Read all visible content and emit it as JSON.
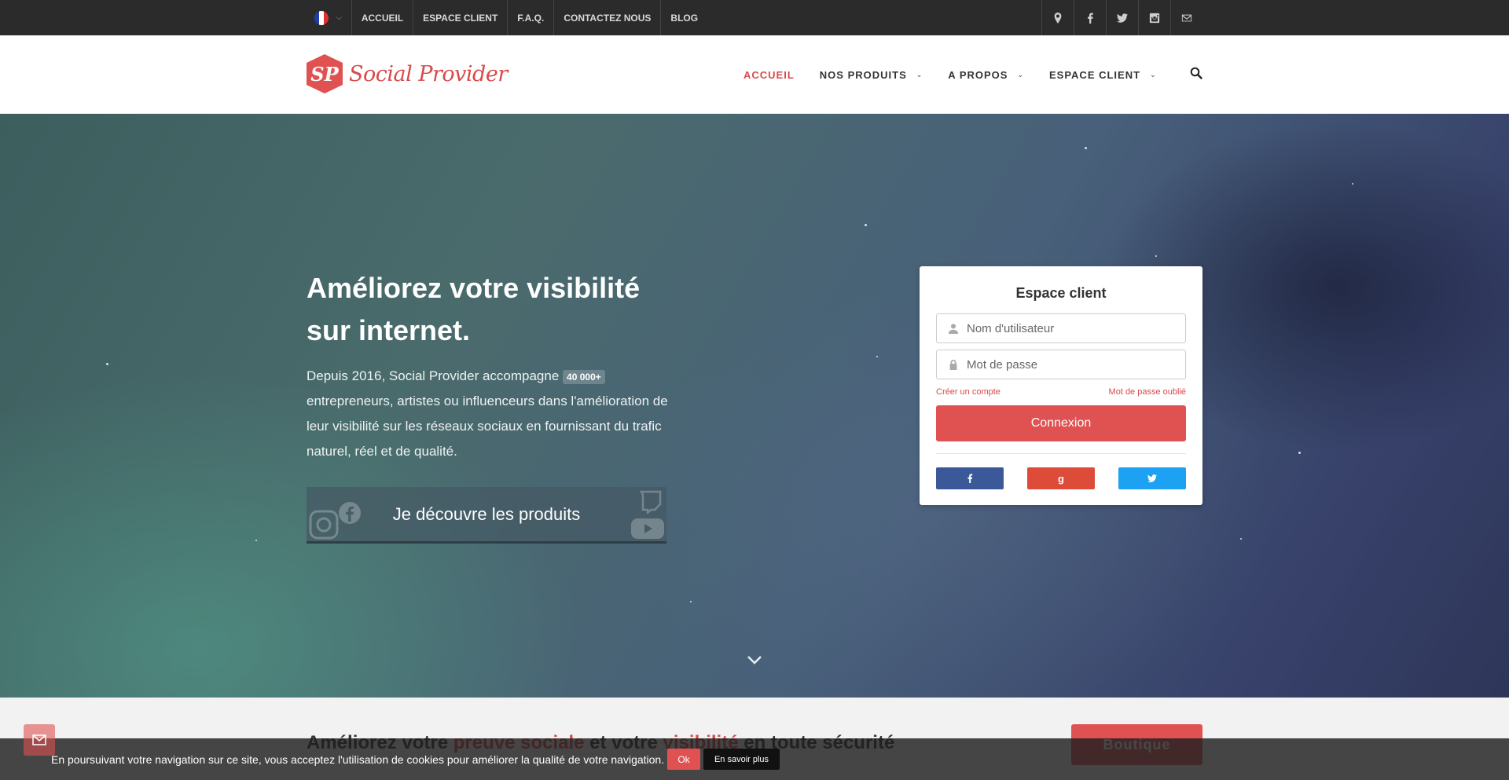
{
  "topbar": {
    "language_flag": "fr-flag-icon",
    "links": [
      "ACCUEIL",
      "ESPACE CLIENT",
      "F.A.Q.",
      "CONTACTEZ NOUS",
      "BLOG"
    ],
    "icons": [
      "map-pin-icon",
      "facebook-icon",
      "twitter-icon",
      "instagram-icon",
      "mail-icon"
    ]
  },
  "header": {
    "logo_mark": "SP",
    "logo_text": "Social Provider",
    "nav": [
      {
        "label": "ACCUEIL",
        "active": true
      },
      {
        "label": "NOS PRODUITS",
        "dropdown": true
      },
      {
        "label": "A PROPOS",
        "dropdown": true
      },
      {
        "label": "ESPACE CLIENT",
        "dropdown": true
      }
    ],
    "search_icon": "search-icon"
  },
  "hero": {
    "title": "Améliorez votre visibilité sur internet.",
    "text_before": "Depuis 2016, Social Provider accompagne",
    "badge": "40 000+",
    "text_after": "entrepreneurs, artistes ou influenceurs dans l'amélioration de leur visibilité sur les réseaux sociaux en fournissant du trafic naturel, réel et de qualité.",
    "cta": "Je découvre les produits"
  },
  "login": {
    "title": "Espace client",
    "username_placeholder": "Nom d'utilisateur",
    "password_placeholder": "Mot de passe",
    "create_account": "Créer un compte",
    "forgot_password": "Mot de passe oublié",
    "submit": "Connexion",
    "social": [
      {
        "icon": "facebook-icon",
        "color": "#3b5998"
      },
      {
        "icon": "google-icon",
        "label": "g",
        "color": "#dd4b39"
      },
      {
        "icon": "twitter-icon",
        "color": "#1da1f2"
      }
    ]
  },
  "section": {
    "title_part1": "Améliorez votre ",
    "title_highlight1": "preuve sociale",
    "title_part2": " et votre ",
    "title_highlight2": "visibilité",
    "title_part3": " en toute sécurité",
    "shop_button": "Boutique"
  },
  "cookie": {
    "text": "En poursuivant votre navigation sur ce site, vous acceptez l'utilisation de cookies pour améliorer la qualité de votre navigation.",
    "ok": "Ok",
    "more": "En savoir plus"
  },
  "colors": {
    "accent": "#e05252",
    "topbar": "#2b2b2b",
    "facebook": "#3b5998",
    "google": "#dd4b39",
    "twitter": "#1da1f2"
  }
}
